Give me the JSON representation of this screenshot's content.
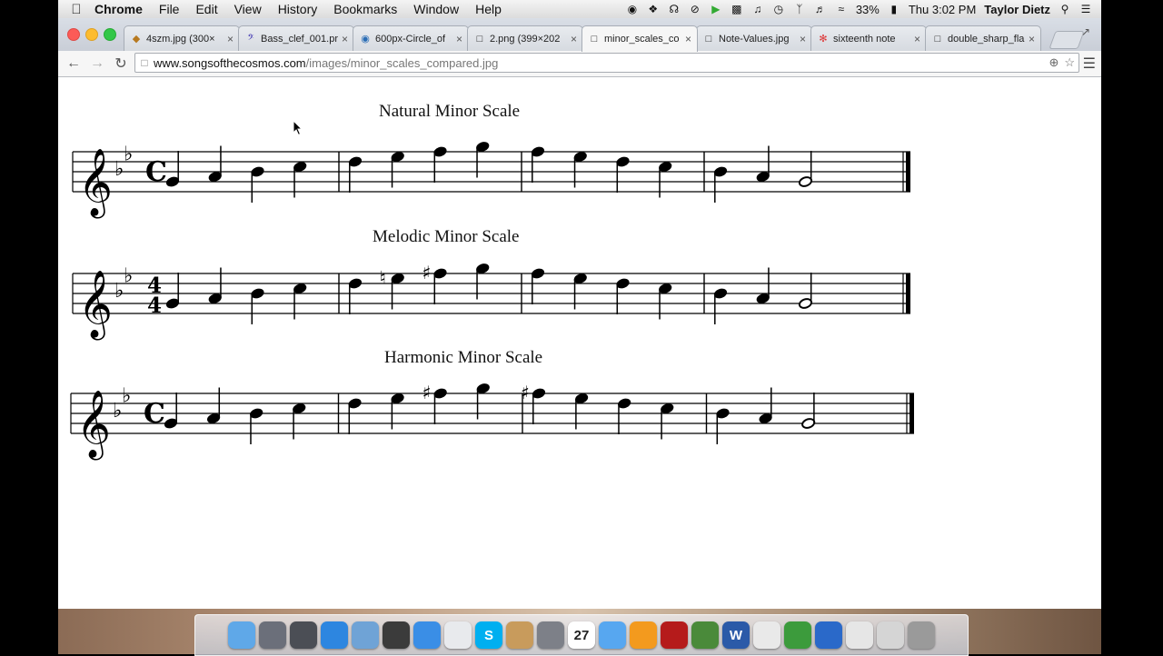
{
  "menubar": {
    "app_name": "Chrome",
    "menus": [
      "File",
      "Edit",
      "View",
      "History",
      "Bookmarks",
      "Window",
      "Help"
    ],
    "battery": "33%",
    "clock": "Thu 3:02 PM",
    "user": "Taylor Dietz"
  },
  "tabs": [
    {
      "label": "4szm.jpg (300×",
      "favicon": "image-icon"
    },
    {
      "label": "Bass_clef_001.pr",
      "favicon": "bass-clef-icon"
    },
    {
      "label": "600px-Circle_of",
      "favicon": "globe-icon"
    },
    {
      "label": "2.png (399×202",
      "favicon": "page-icon"
    },
    {
      "label": "minor_scales_co",
      "favicon": "page-icon",
      "active": true
    },
    {
      "label": "Note-Values.jpg",
      "favicon": "page-icon"
    },
    {
      "label": "sixteenth note",
      "favicon": "google-icon"
    },
    {
      "label": "double_sharp_fla",
      "favicon": "page-icon"
    }
  ],
  "omnibox": {
    "host": "www.songsofthecosmos.com",
    "path": "/images/minor_scales_compared.jpg"
  },
  "scales": [
    {
      "title": "Natural Minor Scale",
      "time_signature": "C",
      "notes": [
        "G4",
        "A4",
        "B4",
        "C5",
        "D5",
        "E5",
        "F5",
        "G5",
        "F5",
        "E5",
        "D5",
        "C5",
        "B4",
        "A4",
        "G4"
      ],
      "accidentals": [
        "",
        "",
        "",
        "",
        "",
        "",
        "",
        "",
        "",
        "",
        "",
        "",
        "",
        "",
        ""
      ]
    },
    {
      "title": "Melodic Minor Scale",
      "time_signature": "4/4",
      "notes": [
        "G4",
        "A4",
        "B4",
        "C5",
        "D5",
        "E5",
        "F5",
        "G5",
        "F5",
        "E5",
        "D5",
        "C5",
        "B4",
        "A4",
        "G4"
      ],
      "accidentals": [
        "",
        "",
        "",
        "",
        "",
        "natural",
        "sharp",
        "",
        "",
        "",
        "",
        "",
        "",
        "",
        ""
      ]
    },
    {
      "title": "Harmonic Minor Scale",
      "time_signature": "C",
      "notes": [
        "G4",
        "A4",
        "B4",
        "C5",
        "D5",
        "E5",
        "F5",
        "G5",
        "F5",
        "E5",
        "D5",
        "C5",
        "B4",
        "A4",
        "G4"
      ],
      "accidentals": [
        "",
        "",
        "",
        "",
        "",
        "",
        "sharp",
        "",
        "sharp",
        "",
        "",
        "",
        "",
        "",
        ""
      ]
    }
  ],
  "key_signature": "B-flat and E-flat (2 flats)",
  "dock_icons": [
    "finder-icon",
    "launchpad-icon",
    "mission-control-icon",
    "app-store-icon",
    "preview-icon",
    "facetime-icon",
    "safari-icon",
    "chrome-icon",
    "skype-icon",
    "contacts-icon",
    "system-preferences-icon",
    "calendar-icon",
    "itunes-icon",
    "ibooks-icon",
    "photo-booth-icon",
    "iphoto-icon",
    "word-icon",
    "textedit-icon",
    "evernote-icon",
    "quicktime-icon",
    "documents-icon",
    "downloads-icon",
    "trash-icon"
  ],
  "calendar_day": "27",
  "dock_letters": {
    "word": "W",
    "skype": "S"
  }
}
